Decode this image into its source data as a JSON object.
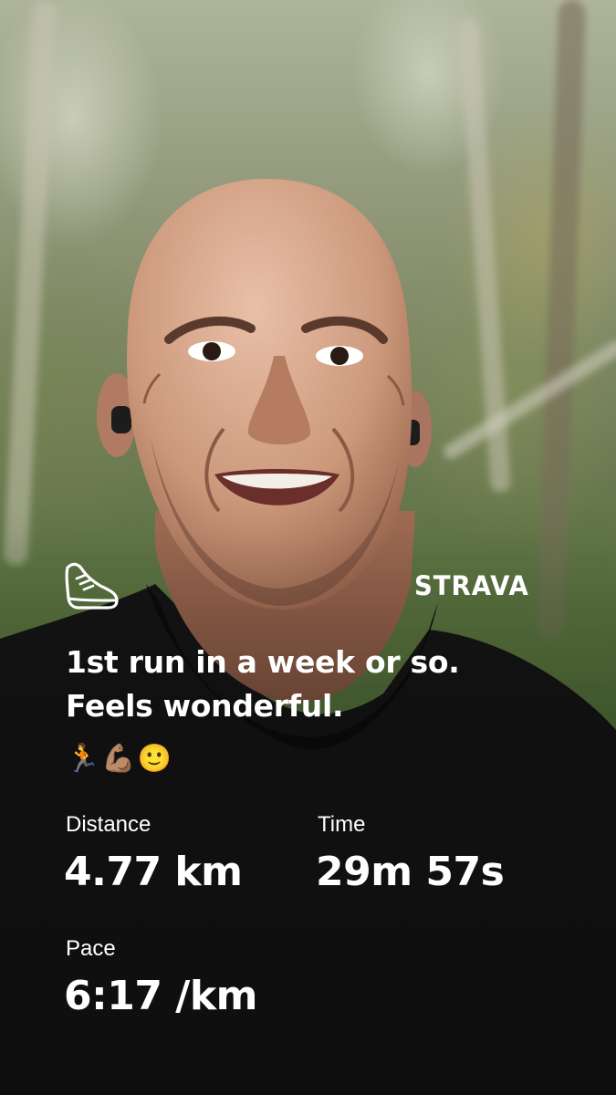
{
  "activity": {
    "icon": "running-shoe-icon",
    "brand": "STRAVA",
    "caption": "1st run in a week or so. Feels wonderful.",
    "caption_emojis": [
      "🏃",
      "💪🏽",
      "🙂"
    ]
  },
  "stats": {
    "distance": {
      "label": "Distance",
      "value": "4.77 km"
    },
    "time": {
      "label": "Time",
      "value": "29m 57s"
    },
    "pace": {
      "label": "Pace",
      "value": "6:17 /km"
    }
  },
  "colors": {
    "text": "#ffffff",
    "shirt": "#141414",
    "skin": "#c9957a",
    "foliage": "#58703f"
  }
}
